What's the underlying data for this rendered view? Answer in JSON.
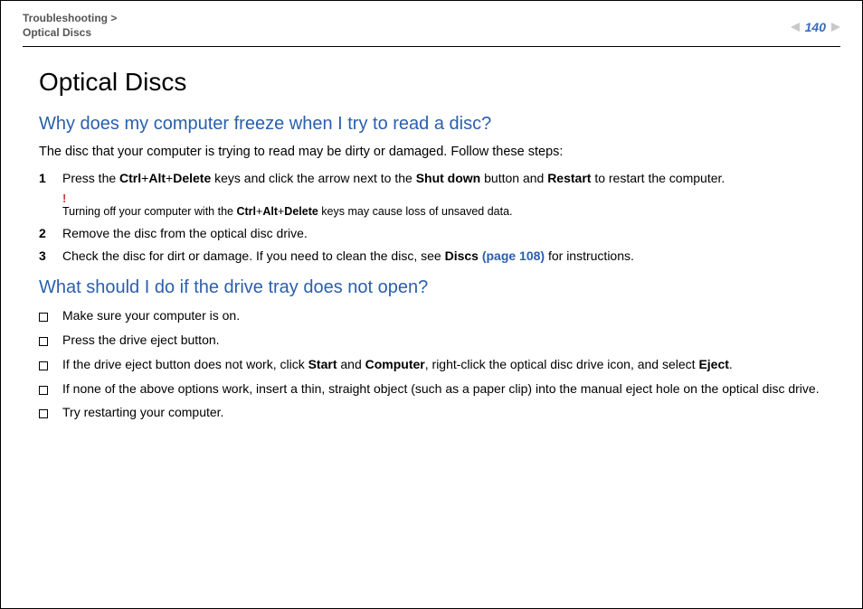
{
  "header": {
    "breadcrumb_parent": "Troubleshooting >",
    "breadcrumb_current": "Optical Discs",
    "page_number": "140"
  },
  "content": {
    "title": "Optical Discs",
    "section1": {
      "heading": "Why does my computer freeze when I try to read a disc?",
      "intro": "The disc that your computer is trying to read may be dirty or damaged. Follow these steps:",
      "step1": {
        "num": "1",
        "pre": "Press the ",
        "k1": "Ctrl",
        "plus1": "+",
        "k2": "Alt",
        "plus2": "+",
        "k3": "Delete",
        "mid1": " keys and click the arrow next to the ",
        "b1": "Shut down",
        "mid2": " button and ",
        "b2": "Restart",
        "post": " to restart the computer."
      },
      "warning": {
        "bang": "!",
        "pre": "Turning off your computer with the ",
        "k1": "Ctrl",
        "plus1": "+",
        "k2": "Alt",
        "plus2": "+",
        "k3": "Delete",
        "post": " keys may cause loss of unsaved data."
      },
      "step2": {
        "num": "2",
        "text": "Remove the disc from the optical disc drive."
      },
      "step3": {
        "num": "3",
        "pre": "Check the disc for dirt or damage. If you need to clean the disc, see ",
        "b1": "Discs ",
        "link": "(page 108)",
        "post": " for instructions."
      }
    },
    "section2": {
      "heading": "What should I do if the drive tray does not open?",
      "b1": "Make sure your computer is on.",
      "b2": "Press the drive eject button.",
      "b3": {
        "pre": "If the drive eject button does not work, click ",
        "s1": "Start",
        "and": " and ",
        "s2": "Computer",
        "mid": ", right-click the optical disc drive icon, and select ",
        "s3": "Eject",
        "post": "."
      },
      "b4": "If none of the above options work, insert a thin, straight object (such as a paper clip) into the manual eject hole on the optical disc drive.",
      "b5": "Try restarting your computer."
    }
  }
}
